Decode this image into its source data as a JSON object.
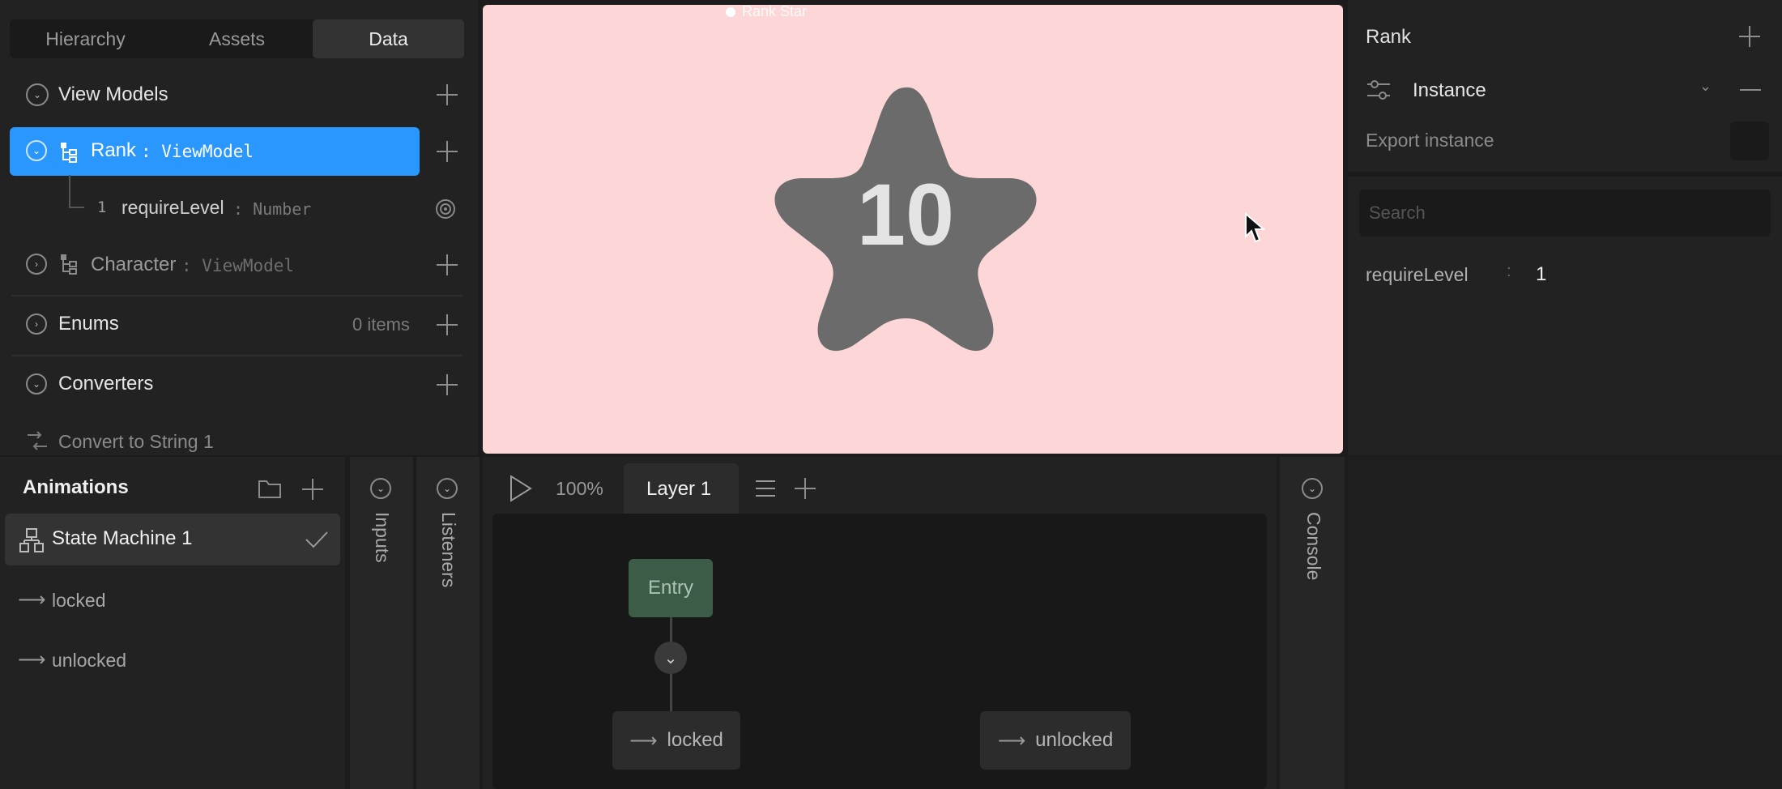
{
  "left_tabs": [
    "Hierarchy",
    "Assets",
    "Data"
  ],
  "view_models": {
    "section_label": "View Models",
    "rank_name": "Rank",
    "rank_type": ": ViewModel",
    "prop_index": "1",
    "prop_name": "requireLevel",
    "prop_type": ": Number",
    "character_name": "Character",
    "character_type": ": ViewModel"
  },
  "enums": {
    "label": "Enums",
    "count": "0 items"
  },
  "converters": {
    "label": "Converters",
    "item": "Convert to String 1"
  },
  "canvas": {
    "artboard_name": "Rank Star",
    "star_number": "10"
  },
  "right": {
    "title": "Rank",
    "instance_label": "Instance",
    "export_label": "Export instance",
    "search_placeholder": "Search",
    "prop_name": "requireLevel",
    "prop_sep": ":",
    "prop_value": "1"
  },
  "animations": {
    "title": "Animations",
    "state_machine": "State Machine 1",
    "items": [
      "locked",
      "unlocked"
    ]
  },
  "side_tabs": {
    "inputs": "Inputs",
    "listeners": "Listeners",
    "console": "Console"
  },
  "graph": {
    "zoom": "100%",
    "layer": "Layer 1",
    "entry": "Entry",
    "node_locked": "locked",
    "node_unlocked": "unlocked"
  },
  "colors": {
    "accent": "#2a97ff",
    "canvas_bg": "#fdd7d7",
    "star": "#6b6b6b",
    "entry_node": "#3c5c48"
  }
}
